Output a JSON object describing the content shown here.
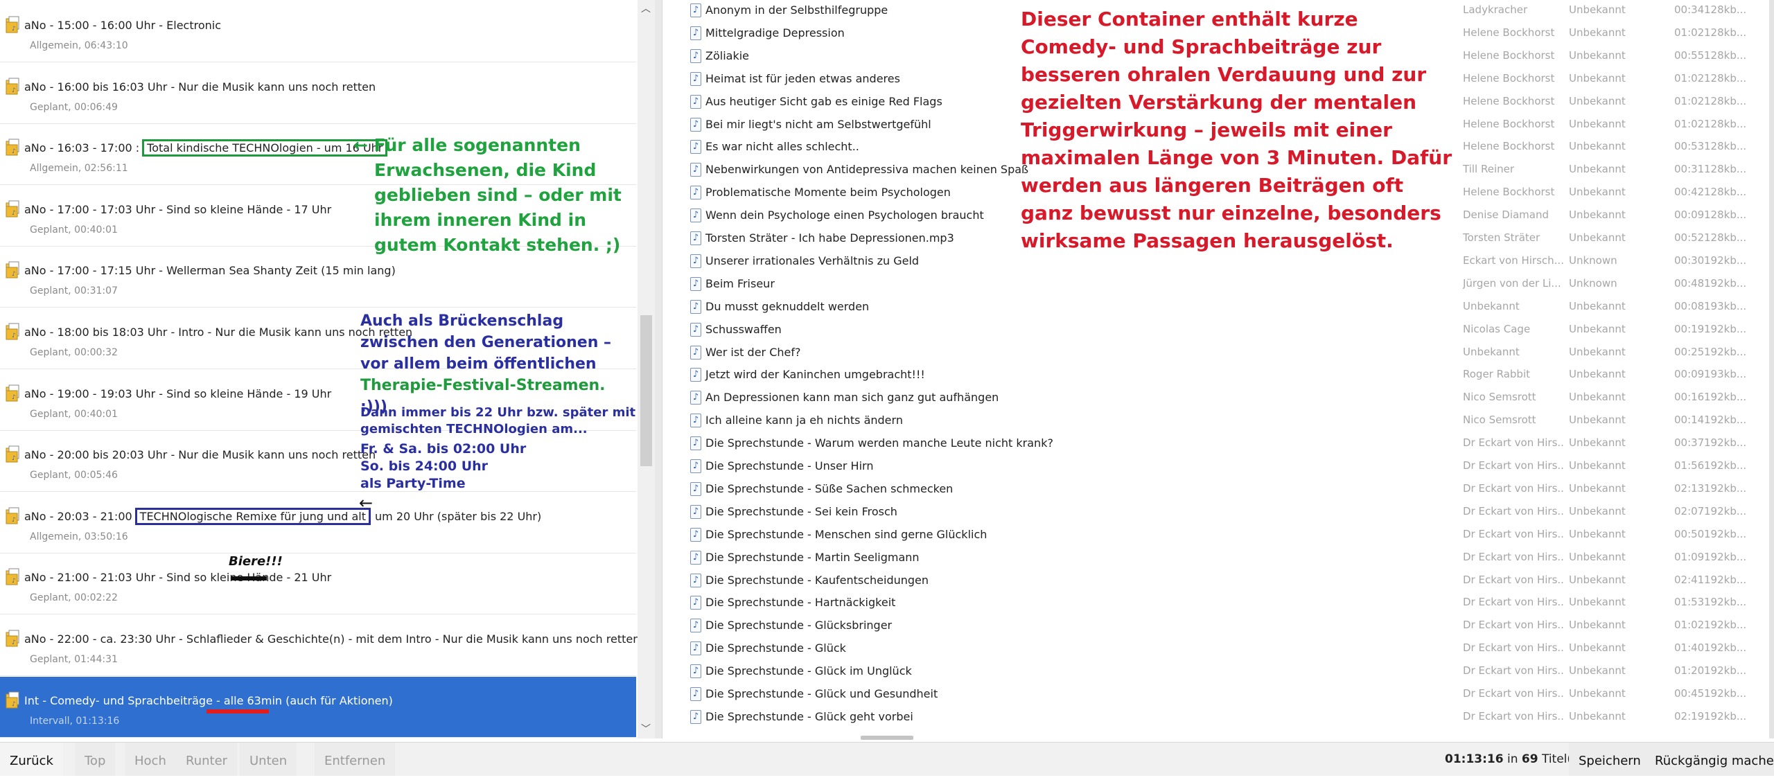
{
  "schedule": [
    {
      "title": "aNo - 15:00 - 16:00 Uhr - Electronic",
      "meta": "Allgemein, 06:43:10"
    },
    {
      "title": "aNo - 16:00 bis 16:03 Uhr - Nur die Musik kann uns noch retten",
      "meta": "Geplant, 00:06:49"
    },
    {
      "title": "aNo - 16:03 - 17:00 :",
      "boxed": "Total kindische TECHNOlogien - um 16 Uhr",
      "meta": "Allgemein, 02:56:11"
    },
    {
      "title": "aNo - 17:00 - 17:03 Uhr - Sind so kleine Hände - 17 Uhr",
      "meta": "Geplant, 00:40:01"
    },
    {
      "title": "aNo - 17:00 - 17:15 Uhr - Wellerman Sea Shanty Zeit (15 min lang)",
      "meta": "Geplant, 00:31:07"
    },
    {
      "title": "aNo - 18:00 bis 18:03 Uhr - Intro - Nur die Musik kann uns noch retten",
      "meta": "Geplant, 00:00:32"
    },
    {
      "title": "aNo - 19:00 - 19:03 Uhr - Sind so kleine Hände - 19 Uhr",
      "meta": "Geplant, 00:40:01"
    },
    {
      "title": "aNo - 20:00 bis 20:03 Uhr - Nur die Musik kann uns noch retten",
      "meta": "Geplant, 00:05:46"
    },
    {
      "title": "aNo - 20:03 - 21:00",
      "boxed": "TECHNOlogische Remixe für jung und alt",
      "after": "um 20 Uhr (später bis 22 Uhr)",
      "meta": "Allgemein, 03:50:16"
    },
    {
      "title": "aNo - 21:00 - 21:03 Uhr - Sind so kleine Hände - 21 Uhr",
      "meta": "Geplant, 00:02:22"
    },
    {
      "title": "aNo - 22:00 - ca. 23:30 Uhr - Schlaflieder & Geschichte(n) - mit dem Intro - Nur die Musik kann uns noch retten",
      "meta": "Geplant, 01:44:31"
    },
    {
      "title": "Int - Comedy- und Sprachbeiträge - alle 63min (auch für Aktionen)",
      "meta": "Intervall, 01:13:16",
      "selected": true
    }
  ],
  "tracks": [
    {
      "title": "Anonym in der Selbsthilfegruppe",
      "artist": "Ladykracher",
      "album": "Unbekannt",
      "duration": "00:34",
      "bitrate": "128kb..."
    },
    {
      "title": "Mittelgradige Depression",
      "artist": "Helene Bockhorst",
      "album": "Unbekannt",
      "duration": "01:02",
      "bitrate": "128kb..."
    },
    {
      "title": "Zöliakie",
      "artist": "Helene Bockhorst",
      "album": "Unbekannt",
      "duration": "00:55",
      "bitrate": "128kb..."
    },
    {
      "title": "Heimat ist für jeden etwas anderes",
      "artist": "Helene Bockhorst",
      "album": "Unbekannt",
      "duration": "01:02",
      "bitrate": "128kb..."
    },
    {
      "title": "Aus heutiger Sicht gab es einige Red Flags",
      "artist": "Helene Bockhorst",
      "album": "Unbekannt",
      "duration": "01:02",
      "bitrate": "128kb..."
    },
    {
      "title": "Bei mir liegt's nicht am Selbstwertgefühl",
      "artist": "Helene Bockhorst",
      "album": "Unbekannt",
      "duration": "01:02",
      "bitrate": "128kb..."
    },
    {
      "title": "Es war nicht alles schlecht..",
      "artist": "Helene Bockhorst",
      "album": "Unbekannt",
      "duration": "00:53",
      "bitrate": "128kb..."
    },
    {
      "title": "Nebenwirkungen von Antidepressiva machen keinen Spaß",
      "artist": "Till Reiner",
      "album": "Unbekannt",
      "duration": "00:31",
      "bitrate": "128kb..."
    },
    {
      "title": "Problematische Momente beim Psychologen",
      "artist": "Helene Bockhorst",
      "album": "Unbekannt",
      "duration": "00:42",
      "bitrate": "128kb..."
    },
    {
      "title": "Wenn dein Psychologe einen Psychologen braucht",
      "artist": "Denise Diamand",
      "album": "Unbekannt",
      "duration": "00:09",
      "bitrate": "128kb..."
    },
    {
      "title": "Torsten Sträter - Ich habe Depressionen.mp3",
      "artist": "Torsten Sträter",
      "album": "Unbekannt",
      "duration": "00:52",
      "bitrate": "128kb..."
    },
    {
      "title": "Unserer irrationales Verhältnis zu Geld",
      "artist": "Eckart von Hirsch...",
      "album": "Unknown",
      "duration": "00:30",
      "bitrate": "192kb..."
    },
    {
      "title": "Beim Friseur",
      "artist": "Jürgen von der Li...",
      "album": "Unknown",
      "duration": "00:48",
      "bitrate": "192kb..."
    },
    {
      "title": "Du musst geknuddelt werden",
      "artist": "Unbekannt",
      "album": "Unbekannt",
      "duration": "00:08",
      "bitrate": "193kb..."
    },
    {
      "title": "Schusswaffen",
      "artist": "Nicolas Cage",
      "album": "Unbekannt",
      "duration": "00:19",
      "bitrate": "192kb..."
    },
    {
      "title": "Wer ist der Chef?",
      "artist": "Unbekannt",
      "album": "Unbekannt",
      "duration": "00:25",
      "bitrate": "192kb..."
    },
    {
      "title": "Jetzt wird der Kaninchen umgebracht!!!",
      "artist": "Roger Rabbit",
      "album": "Unbekannt",
      "duration": "00:09",
      "bitrate": "193kb..."
    },
    {
      "title": "An Depressionen kann man sich ganz gut aufhängen",
      "artist": "Nico Semsrott",
      "album": "Unbekannt",
      "duration": "00:16",
      "bitrate": "192kb..."
    },
    {
      "title": "Ich alleine kann ja eh nichts ändern",
      "artist": "Nico Semsrott",
      "album": "Unbekannt",
      "duration": "00:14",
      "bitrate": "192kb..."
    },
    {
      "title": "Die Sprechstunde - Warum werden manche Leute nicht krank?",
      "artist": "Dr Eckart von Hirs...",
      "album": "Unbekannt",
      "duration": "00:37",
      "bitrate": "192kb..."
    },
    {
      "title": "Die Sprechstunde - Unser Hirn",
      "artist": "Dr Eckart von Hirs...",
      "album": "Unbekannt",
      "duration": "01:56",
      "bitrate": "192kb..."
    },
    {
      "title": "Die Sprechstunde - Süße Sachen schmecken",
      "artist": "Dr Eckart von Hirs...",
      "album": "Unbekannt",
      "duration": "02:13",
      "bitrate": "192kb..."
    },
    {
      "title": "Die Sprechstunde - Sei kein Frosch",
      "artist": "Dr Eckart von Hirs...",
      "album": "Unbekannt",
      "duration": "02:07",
      "bitrate": "192kb..."
    },
    {
      "title": "Die Sprechstunde - Menschen sind gerne Glücklich",
      "artist": "Dr Eckart von Hirs...",
      "album": "Unbekannt",
      "duration": "00:50",
      "bitrate": "192kb..."
    },
    {
      "title": "Die Sprechstunde - Martin Seeligmann",
      "artist": "Dr Eckart von Hirs...",
      "album": "Unbekannt",
      "duration": "01:09",
      "bitrate": "192kb..."
    },
    {
      "title": "Die Sprechstunde - Kaufentscheidungen",
      "artist": "Dr Eckart von Hirs...",
      "album": "Unbekannt",
      "duration": "02:41",
      "bitrate": "192kb..."
    },
    {
      "title": "Die Sprechstunde - Hartnäckigkeit",
      "artist": "Dr Eckart von Hirs...",
      "album": "Unbekannt",
      "duration": "01:53",
      "bitrate": "192kb..."
    },
    {
      "title": "Die Sprechstunde - Glücksbringer",
      "artist": "Dr Eckart von Hirs...",
      "album": "Unbekannt",
      "duration": "01:02",
      "bitrate": "192kb..."
    },
    {
      "title": "Die Sprechstunde - Glück",
      "artist": "Dr Eckart von Hirs...",
      "album": "Unbekannt",
      "duration": "01:40",
      "bitrate": "192kb..."
    },
    {
      "title": "Die Sprechstunde - Glück im Unglück",
      "artist": "Dr Eckart von Hirs...",
      "album": "Unbekannt",
      "duration": "01:20",
      "bitrate": "192kb..."
    },
    {
      "title": "Die Sprechstunde - Glück und Gesundheit",
      "artist": "Dr Eckart von Hirs...",
      "album": "Unbekannt",
      "duration": "00:45",
      "bitrate": "192kb..."
    },
    {
      "title": "Die Sprechstunde - Glück geht vorbei",
      "artist": "Dr Eckart von Hirs...",
      "album": "Unbekannt",
      "duration": "02:19",
      "bitrate": "192kb..."
    }
  ],
  "annotations": {
    "red_text": "Dieser Container enthält kurze Comedy- und Sprachbeiträge zur besseren ohralen Verdauung und zur gezielten Verstärkung der mentalen Triggerwirkung – jeweils mit einer maximalen Länge von 3 Minuten. Dafür werden aus längeren Beiträgen oft ganz bewusst nur einzelne, besonders wirksame Passagen herausgelöst.",
    "green_arrow": "←",
    "green_text": "Für alle sogenannten Erwachsenen, die Kind geblieben sind – oder mit ihrem inneren Kind in gutem Kontakt stehen. ;)",
    "bridge_text": "Auch als Brückenschlag zwischen den Generationen – vor allem beim öffentlichen",
    "bridge_green": "Therapie-Festival-Streamen.",
    "bridge_smiley": ":)))",
    "daily_text": "Dann immer bis 22 Uhr bzw. später mit gemischten TECHNOlogien am...",
    "weekend_line1": "Fr. & Sa. bis 02:00 Uhr",
    "weekend_line2": "So. bis 24:00 Uhr",
    "weekend_line3": "als Party-Time",
    "left_arrow": "←",
    "biere": "Biere!!!"
  },
  "toolbar": {
    "back": "Zurück",
    "top": "Top",
    "up": "Hoch",
    "down": "Runter",
    "bottom": "Unten",
    "remove": "Entfernen",
    "total_time": "01:13:16",
    "in": "in",
    "count": "69",
    "titles_suffix": "Titel(n)",
    "save": "Speichern",
    "undo": "Rückgängig machen"
  },
  "colors": {
    "selection": "#2f6fd0",
    "annotation_red": "#d7192a",
    "annotation_green": "#20a23f",
    "annotation_navy": "#2a2fa0"
  }
}
